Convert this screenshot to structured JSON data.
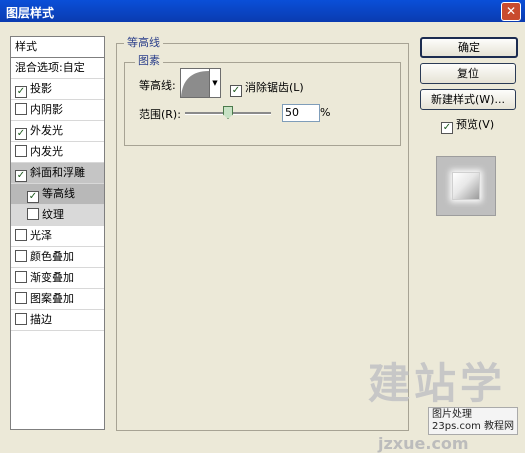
{
  "window": {
    "title": "图层样式",
    "close_glyph": "✕"
  },
  "style_list": {
    "header": "样式",
    "blend_options": "混合选项:自定",
    "items": [
      {
        "label": "投影",
        "checked": true
      },
      {
        "label": "内阴影",
        "checked": false
      },
      {
        "label": "外发光",
        "checked": true
      },
      {
        "label": "内发光",
        "checked": false
      },
      {
        "label": "斜面和浮雕",
        "checked": true
      },
      {
        "label": "等高线",
        "checked": true
      },
      {
        "label": "纹理",
        "checked": false
      },
      {
        "label": "光泽",
        "checked": false
      },
      {
        "label": "颜色叠加",
        "checked": false
      },
      {
        "label": "渐变叠加",
        "checked": false
      },
      {
        "label": "图案叠加",
        "checked": false
      },
      {
        "label": "描边",
        "checked": false
      }
    ],
    "check_glyph": "✓"
  },
  "panel": {
    "title": "等高线",
    "group_title": "图素",
    "contour_label": "等高线:",
    "antialias_label": "消除锯齿(L)",
    "antialias_checked": true,
    "range_label": "范围(R):",
    "range_value": "50",
    "range_fraction": 0.5,
    "percent": "%",
    "dropdown_glyph": "▼"
  },
  "buttons": {
    "ok": "确定",
    "reset": "复位",
    "new_style": "新建样式(W)...",
    "preview_label": "预览(V)",
    "preview_checked": true
  },
  "watermark": {
    "big": "建站学",
    "small_line1": "图片处理",
    "small_line2": "23ps.com 教程网",
    "url": "jzxue.com"
  }
}
